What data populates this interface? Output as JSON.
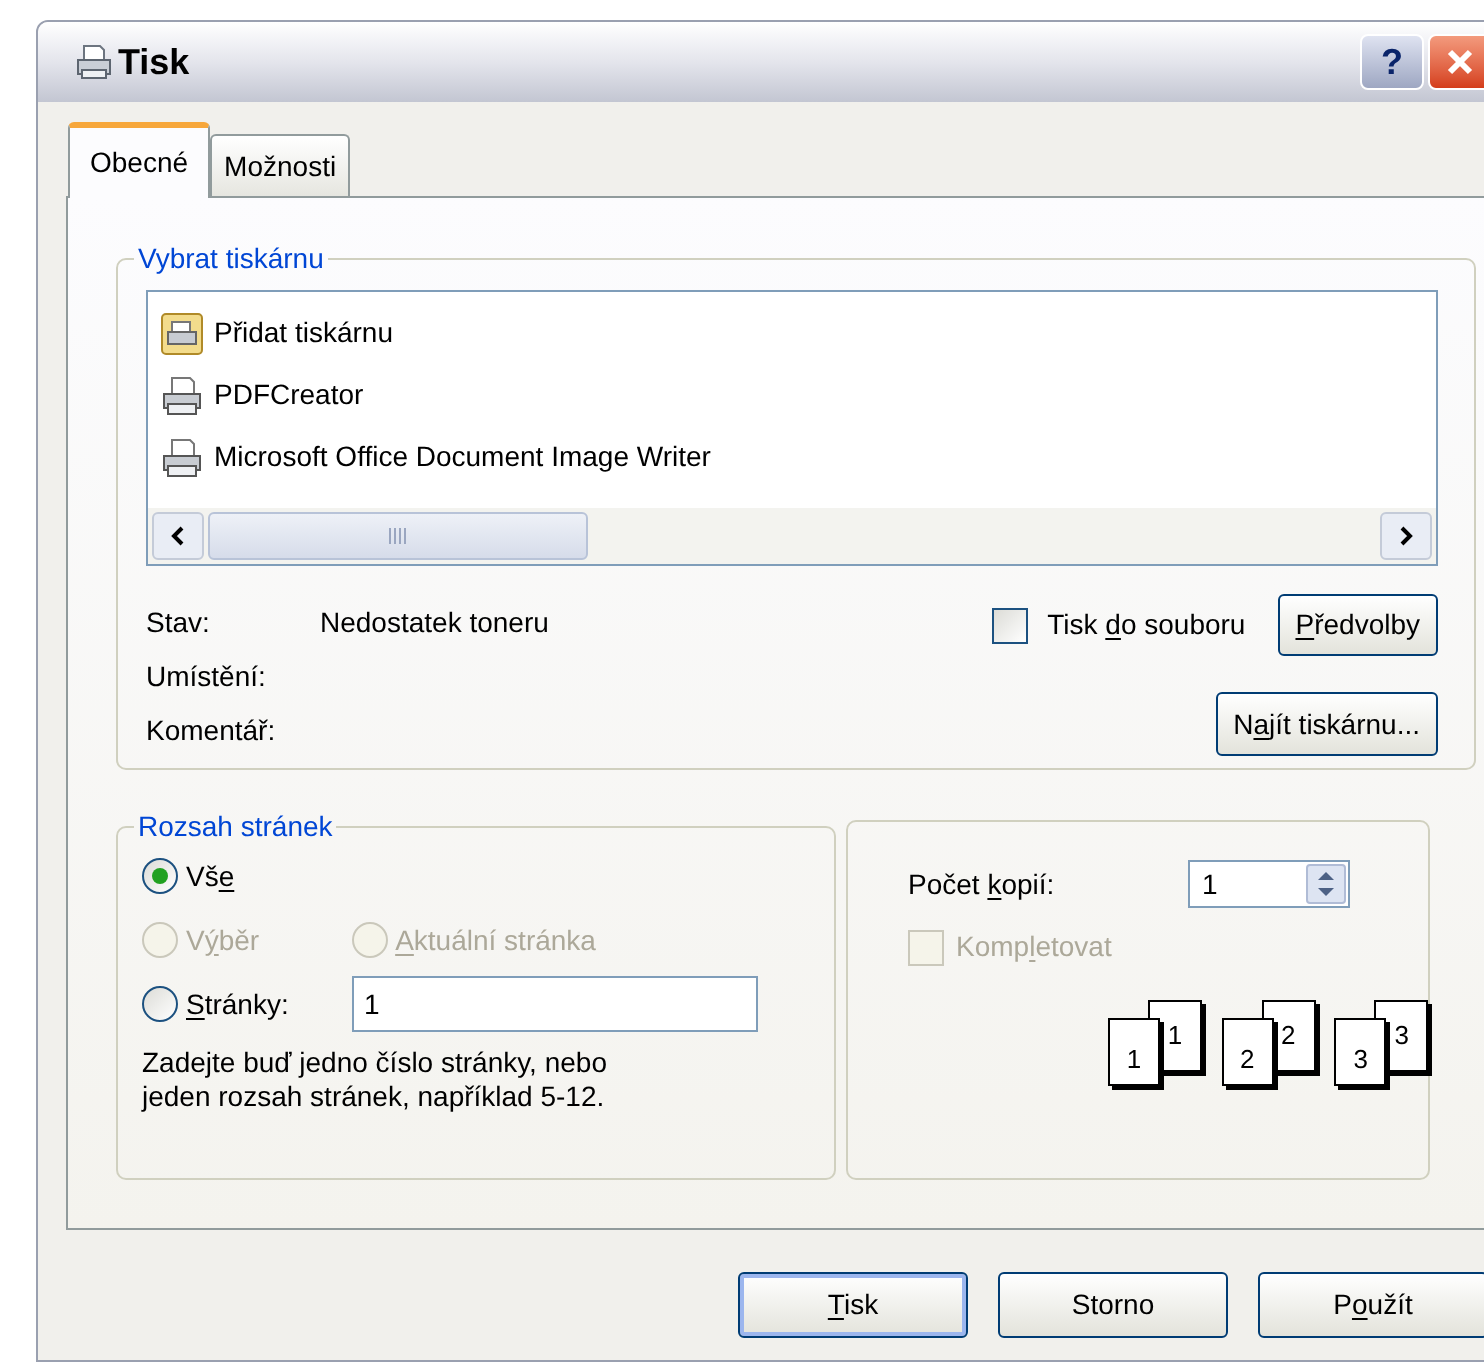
{
  "window": {
    "title": "Tisk",
    "help_button": "?"
  },
  "tabs": [
    {
      "label": "Obecné",
      "selected": true
    },
    {
      "label": "Možnosti",
      "selected": false
    }
  ],
  "printer_group": {
    "title": "Vybrat tiskárnu",
    "printers": [
      {
        "name": "Přidat tiskárnu",
        "kind": "add",
        "selected": false
      },
      {
        "name": "PDFCreator",
        "kind": "printer",
        "selected": false
      },
      {
        "name": "Microsoft Office Document Image Writer",
        "kind": "printer",
        "selected": false
      }
    ],
    "status": [
      {
        "label": "Stav:",
        "value": "Nedostatek toneru"
      },
      {
        "label": "Umístění:"
      },
      {
        "label": "Komentář:"
      }
    ],
    "print_to_file": {
      "label": [
        {
          "text": "Tisk "
        },
        {
          "text": "d",
          "underlined": true
        },
        {
          "text": "o souboru"
        }
      ],
      "checked": false
    },
    "preferences_button": [
      {
        "text": "P",
        "underlined": true
      },
      {
        "text": "ředvolby"
      }
    ],
    "find_printer_button": [
      {
        "text": "N"
      },
      {
        "text": "a",
        "underlined": true
      },
      {
        "text": "jít tiskárnu..."
      }
    ]
  },
  "page_range": {
    "title": "Rozsah stránek",
    "options": [
      {
        "label": [
          {
            "text": "Vš"
          },
          {
            "text": "e",
            "underlined": true
          }
        ],
        "selected": true,
        "disabled": false
      },
      {
        "label": [
          {
            "text": "V"
          },
          {
            "text": "ý",
            "underlined": true
          },
          {
            "text": "běr"
          }
        ],
        "selected": false,
        "disabled": true
      },
      {
        "label": [
          {
            "text": "A",
            "underlined": true
          },
          {
            "text": "ktuální stránka"
          }
        ],
        "selected": false,
        "disabled": true
      },
      {
        "label": [
          {
            "text": "S",
            "underlined": true
          },
          {
            "text": "tránky:"
          }
        ],
        "selected": false,
        "disabled": false
      }
    ],
    "pages_value": "1",
    "hint": [
      "Zadejte buď jedno číslo stránky, nebo",
      "jeden rozsah stránek, například 5-12."
    ]
  },
  "copies": {
    "label": [
      {
        "text": "Počet "
      },
      {
        "text": "k",
        "underlined": true
      },
      {
        "text": "opií:"
      }
    ],
    "value": "1",
    "collate": {
      "label": [
        {
          "text": "Komp"
        },
        {
          "text": "l",
          "underlined": true
        },
        {
          "text": "etovat"
        }
      ],
      "checked": false,
      "disabled": true
    },
    "collate_pages": [
      {
        "front": "1",
        "back": "1"
      },
      {
        "front": "2",
        "back": "2"
      },
      {
        "front": "3",
        "back": "3"
      }
    ]
  },
  "buttons": [
    {
      "label": [
        {
          "text": "T",
          "underlined": true
        },
        {
          "text": "isk"
        }
      ],
      "default": true
    },
    {
      "label": [
        {
          "text": "Storno"
        }
      ],
      "default": false
    },
    {
      "label": [
        {
          "text": "P"
        },
        {
          "text": "o",
          "underlined": true
        },
        {
          "text": "užít"
        }
      ],
      "default": false
    }
  ]
}
